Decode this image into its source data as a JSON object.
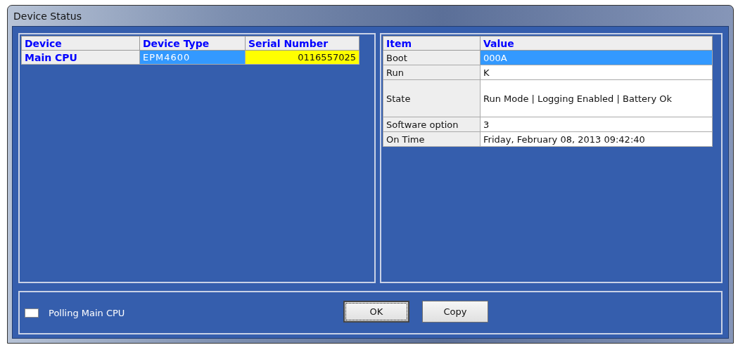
{
  "window": {
    "title": "Device Status"
  },
  "devices": {
    "columns": [
      "Device",
      "Device Type",
      "Serial Number"
    ],
    "rows": [
      {
        "device": "Main CPU",
        "device_type": "EPM4600",
        "serial_number": "0116557025",
        "selected": true
      }
    ]
  },
  "details": {
    "columns": [
      "Item",
      "Value"
    ],
    "rows": [
      {
        "item": "Boot",
        "value": "000A",
        "selected": true,
        "tall": false
      },
      {
        "item": "Run",
        "value": "K",
        "selected": false,
        "tall": false
      },
      {
        "item": "State",
        "value": "Run Mode | Logging Enabled | Battery Ok",
        "selected": false,
        "tall": true
      },
      {
        "item": "Software option",
        "value": "3",
        "selected": false,
        "tall": false
      },
      {
        "item": "On Time",
        "value": "Friday, February 08, 2013 09:42:40",
        "selected": false,
        "tall": false
      }
    ]
  },
  "polling": {
    "label": "Polling Main CPU"
  },
  "buttons": [
    {
      "label": "OK",
      "focused": true
    },
    {
      "label": "Copy",
      "focused": false
    }
  ]
}
